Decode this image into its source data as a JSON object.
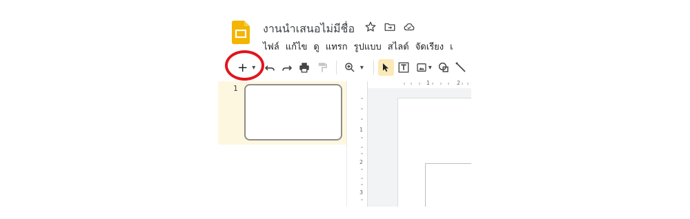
{
  "header": {
    "doc_title": "งานนำเสนอไม่มีชื่อ",
    "icons": [
      "star-icon",
      "move-to-folder-icon",
      "cloud-status-icon"
    ]
  },
  "menu": {
    "items": [
      "ไฟล์",
      "แก้ไข",
      "ดู",
      "แทรก",
      "รูปแบบ",
      "สไลด์",
      "จัดเรียง",
      "เ"
    ]
  },
  "toolbar": {
    "buttons": [
      "new-slide",
      "undo",
      "redo",
      "print",
      "paint-format",
      "zoom",
      "select",
      "text-box",
      "image",
      "shape",
      "line"
    ],
    "new_slide_glyph": "+",
    "dropdown_glyph": "▾"
  },
  "filmstrip": {
    "slides": [
      {
        "number": "1"
      }
    ]
  },
  "rulers": {
    "horizontal_ticks": [
      "1",
      "2"
    ],
    "vertical_ticks": [
      "1",
      "2",
      "3"
    ]
  },
  "colors": {
    "highlight_ring": "#e2141b",
    "filmstrip_bg": "#fef7e0",
    "logo_yellow": "#f4b400",
    "active_tool_bg": "#fbe9b7"
  }
}
